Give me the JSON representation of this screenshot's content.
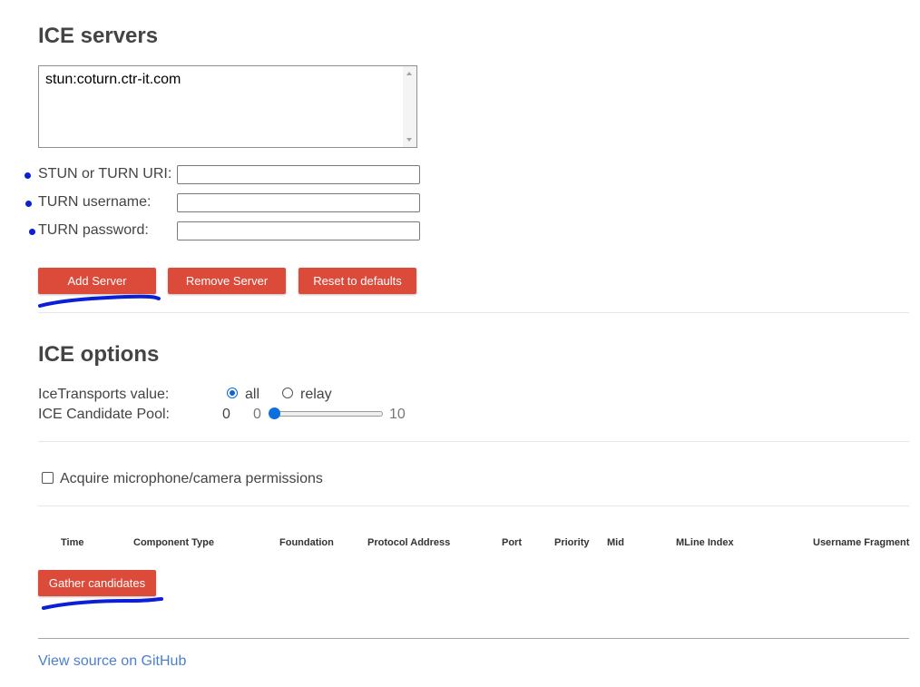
{
  "ice_servers": {
    "heading": "ICE servers",
    "list": [
      "stun:coturn.ctr-it.com"
    ],
    "fields": {
      "uri_label": "STUN or TURN URI:",
      "username_label": "TURN username:",
      "password_label": "TURN password:",
      "uri_value": "",
      "username_value": "",
      "password_value": ""
    },
    "buttons": {
      "add": "Add Server",
      "remove": "Remove Server",
      "reset": "Reset to defaults"
    }
  },
  "ice_options": {
    "heading": "ICE options",
    "transports_label": "IceTransports value:",
    "transport_options": [
      "all",
      "relay"
    ],
    "transport_selected": "all",
    "pool_label": "ICE Candidate Pool:",
    "pool_value": "0",
    "pool_min": "0",
    "pool_max": "10",
    "pool_fraction": 0.0
  },
  "permissions": {
    "label": "Acquire microphone/camera permissions",
    "checked": false
  },
  "candidates_table": {
    "columns": [
      "Time",
      "Component Type",
      "Foundation",
      "Protocol Address",
      "Port",
      "Priority",
      "Mid",
      "MLine Index",
      "Username Fragment"
    ],
    "rows": []
  },
  "gather_button": "Gather candidates",
  "footer": {
    "link": "View source on GitHub"
  },
  "annotation_color": "#0a1fd6"
}
